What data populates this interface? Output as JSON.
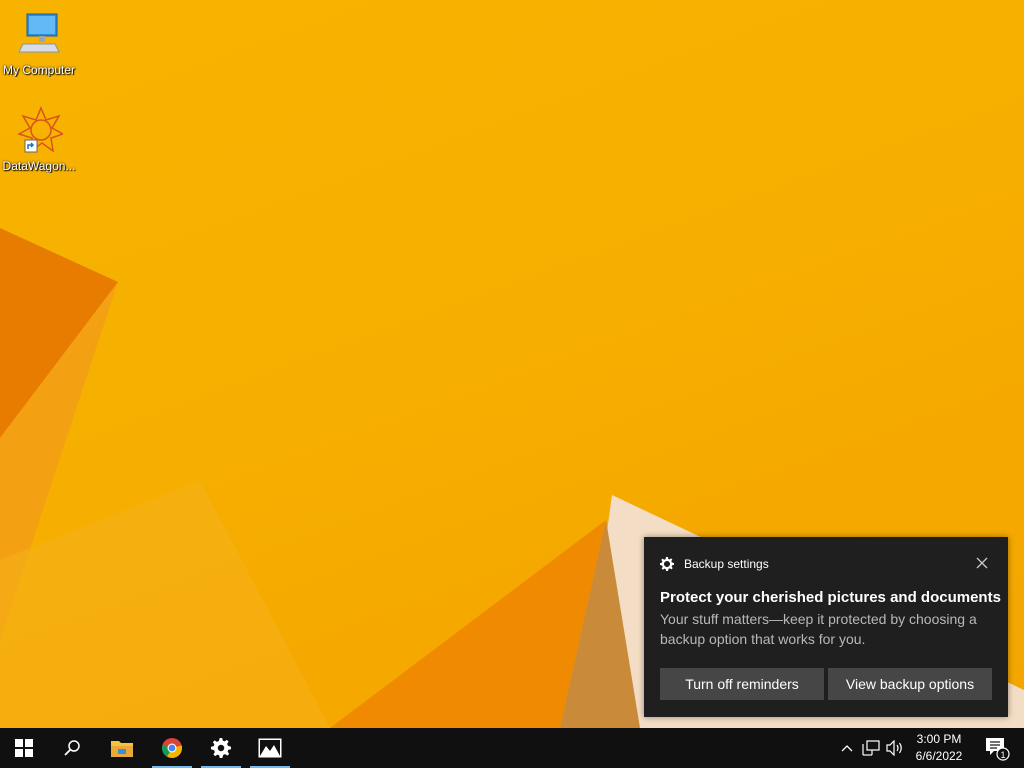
{
  "desktop": {
    "icons": [
      {
        "label": "My Computer",
        "icon": "computer-icon"
      },
      {
        "label": "DataWagon...",
        "icon": "datawagon-shortcut-icon"
      }
    ]
  },
  "toast": {
    "app": "Backup settings",
    "title": "Protect your cherished pictures and documents",
    "body": "Your stuff matters—keep it protected by choosing a backup option that works for you.",
    "buttons": [
      "Turn off reminders",
      "View backup options"
    ]
  },
  "taskbar": {
    "items": [
      "start-icon",
      "search-icon",
      "file-explorer-icon",
      "chrome-icon",
      "settings-icon",
      "photos-icon"
    ],
    "clock": {
      "time": "3:00 PM",
      "date": "6/6/2022"
    },
    "notification_count": "1"
  }
}
